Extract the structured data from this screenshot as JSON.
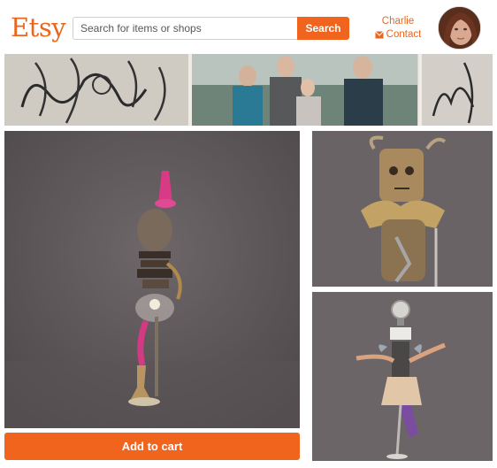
{
  "header": {
    "logo_text": "Etsy",
    "search": {
      "placeholder": "Search for items or shops",
      "button_label": "Search"
    },
    "user": {
      "name": "Charlie",
      "contact_label": "Contact",
      "contact_icon": "envelope-icon"
    },
    "avatar_icon": "user-avatar"
  },
  "banner": {
    "description_icon": "banner-image"
  },
  "gallery": {
    "images": [
      {
        "icon": "product-photo-main"
      },
      {
        "icon": "product-photo-thumbnail"
      },
      {
        "icon": "product-photo-thumbnail"
      }
    ]
  },
  "actions": {
    "add_to_cart_label": "Add to cart"
  },
  "colors": {
    "brand": "#e9661e",
    "button": "#f1641e",
    "photo_background": "#5f5a5c"
  }
}
